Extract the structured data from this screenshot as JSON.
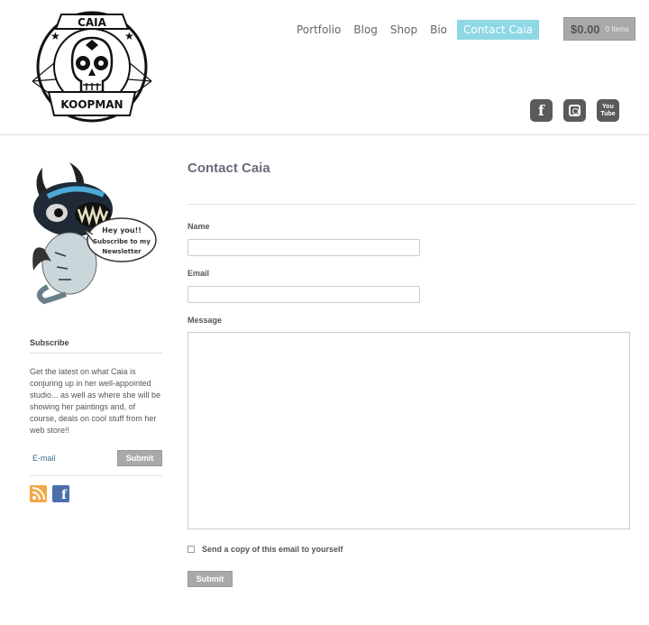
{
  "logo": {
    "top_text": "CAIA",
    "bottom_text": "KOOPMAN"
  },
  "nav": {
    "items": [
      "Portfolio",
      "Blog",
      "Shop",
      "Bio"
    ],
    "active": "Contact Caia"
  },
  "cart": {
    "total": "$0.00",
    "items": "0 Items"
  },
  "social": {
    "facebook": "f",
    "youtube_top": "You",
    "youtube_bottom": "Tube"
  },
  "sidebar": {
    "mascot_bubble_line1": "Hey you!!",
    "mascot_bubble_line2": "Subscribe to my",
    "mascot_bubble_line3": "Newsletter",
    "subscribe_title": "Subscribe",
    "subscribe_text": "Get the latest on what Caia is conjuring up in her well-appointed studio... as well as where she will be showing her paintings and, of course, deals on cool stuff from her web store!!",
    "email_placeholder": "E-mail",
    "submit_label": "Submit",
    "facebook_glyph": "f"
  },
  "main": {
    "title": "Contact Caia",
    "name_label": "Name",
    "email_label": "Email",
    "message_label": "Message",
    "copy_label": "Send a copy of this email to yourself",
    "submit_label": "Submit"
  },
  "colors": {
    "accent": "#8ed8e6",
    "button": "#a9a9a9",
    "title": "#6b6b7a"
  }
}
